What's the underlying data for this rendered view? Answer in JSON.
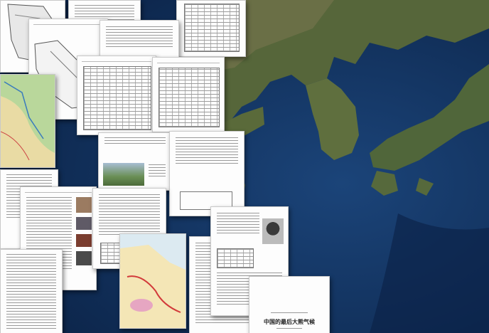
{
  "scene": {
    "description_free": true,
    "background": {
      "kind": "satellite-map",
      "colors": {
        "ocean": "#15386a",
        "deep_ocean": "#0d2a52",
        "land": "#5b6b3c",
        "land_dry": "#8a7f5a"
      }
    },
    "pages": [
      {
        "id": "map-page-top-left",
        "kind": "map"
      },
      {
        "id": "text-page-top",
        "kind": "text"
      },
      {
        "id": "table-page-top-right",
        "kind": "table"
      },
      {
        "id": "map-page-left",
        "kind": "map"
      },
      {
        "id": "text-page-upper-center",
        "kind": "text"
      },
      {
        "id": "color-map-page-left",
        "kind": "color-map"
      },
      {
        "id": "table-page-center",
        "kind": "table"
      },
      {
        "id": "table-page-center-right",
        "kind": "table"
      },
      {
        "id": "photo-page-center",
        "kind": "photo"
      },
      {
        "id": "text-page-center-right",
        "kind": "text"
      },
      {
        "id": "text-page-far-left",
        "kind": "text"
      },
      {
        "id": "photo-page-lower-left",
        "kind": "photo"
      },
      {
        "id": "text-page-lower-center",
        "kind": "text"
      },
      {
        "id": "portrait-page",
        "kind": "photo"
      },
      {
        "id": "map-page-bottom-center",
        "kind": "color-map"
      },
      {
        "id": "text-page-bottom-right",
        "kind": "text"
      },
      {
        "id": "toc-page-bottom-left",
        "kind": "toc"
      },
      {
        "id": "cover-page",
        "kind": "cover"
      }
    ],
    "cover": {
      "title": "中国的最后大熊气候",
      "subtitle": "",
      "author": ""
    }
  }
}
